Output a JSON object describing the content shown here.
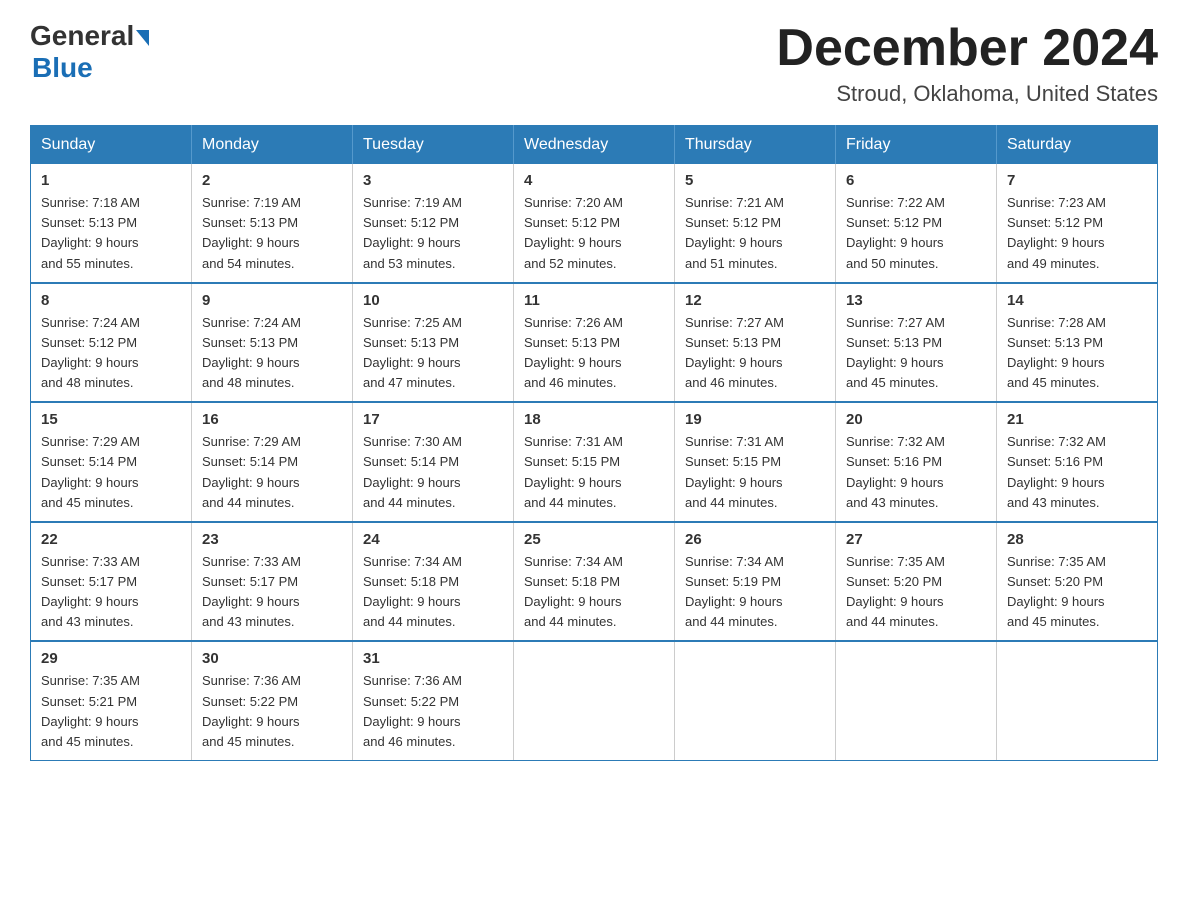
{
  "header": {
    "logo_general": "General",
    "logo_blue": "Blue",
    "title": "December 2024",
    "subtitle": "Stroud, Oklahoma, United States"
  },
  "columns": [
    "Sunday",
    "Monday",
    "Tuesday",
    "Wednesday",
    "Thursday",
    "Friday",
    "Saturday"
  ],
  "weeks": [
    [
      {
        "day": "1",
        "sunrise": "7:18 AM",
        "sunset": "5:13 PM",
        "daylight": "9 hours and 55 minutes."
      },
      {
        "day": "2",
        "sunrise": "7:19 AM",
        "sunset": "5:13 PM",
        "daylight": "9 hours and 54 minutes."
      },
      {
        "day": "3",
        "sunrise": "7:19 AM",
        "sunset": "5:12 PM",
        "daylight": "9 hours and 53 minutes."
      },
      {
        "day": "4",
        "sunrise": "7:20 AM",
        "sunset": "5:12 PM",
        "daylight": "9 hours and 52 minutes."
      },
      {
        "day": "5",
        "sunrise": "7:21 AM",
        "sunset": "5:12 PM",
        "daylight": "9 hours and 51 minutes."
      },
      {
        "day": "6",
        "sunrise": "7:22 AM",
        "sunset": "5:12 PM",
        "daylight": "9 hours and 50 minutes."
      },
      {
        "day": "7",
        "sunrise": "7:23 AM",
        "sunset": "5:12 PM",
        "daylight": "9 hours and 49 minutes."
      }
    ],
    [
      {
        "day": "8",
        "sunrise": "7:24 AM",
        "sunset": "5:12 PM",
        "daylight": "9 hours and 48 minutes."
      },
      {
        "day": "9",
        "sunrise": "7:24 AM",
        "sunset": "5:13 PM",
        "daylight": "9 hours and 48 minutes."
      },
      {
        "day": "10",
        "sunrise": "7:25 AM",
        "sunset": "5:13 PM",
        "daylight": "9 hours and 47 minutes."
      },
      {
        "day": "11",
        "sunrise": "7:26 AM",
        "sunset": "5:13 PM",
        "daylight": "9 hours and 46 minutes."
      },
      {
        "day": "12",
        "sunrise": "7:27 AM",
        "sunset": "5:13 PM",
        "daylight": "9 hours and 46 minutes."
      },
      {
        "day": "13",
        "sunrise": "7:27 AM",
        "sunset": "5:13 PM",
        "daylight": "9 hours and 45 minutes."
      },
      {
        "day": "14",
        "sunrise": "7:28 AM",
        "sunset": "5:13 PM",
        "daylight": "9 hours and 45 minutes."
      }
    ],
    [
      {
        "day": "15",
        "sunrise": "7:29 AM",
        "sunset": "5:14 PM",
        "daylight": "9 hours and 45 minutes."
      },
      {
        "day": "16",
        "sunrise": "7:29 AM",
        "sunset": "5:14 PM",
        "daylight": "9 hours and 44 minutes."
      },
      {
        "day": "17",
        "sunrise": "7:30 AM",
        "sunset": "5:14 PM",
        "daylight": "9 hours and 44 minutes."
      },
      {
        "day": "18",
        "sunrise": "7:31 AM",
        "sunset": "5:15 PM",
        "daylight": "9 hours and 44 minutes."
      },
      {
        "day": "19",
        "sunrise": "7:31 AM",
        "sunset": "5:15 PM",
        "daylight": "9 hours and 44 minutes."
      },
      {
        "day": "20",
        "sunrise": "7:32 AM",
        "sunset": "5:16 PM",
        "daylight": "9 hours and 43 minutes."
      },
      {
        "day": "21",
        "sunrise": "7:32 AM",
        "sunset": "5:16 PM",
        "daylight": "9 hours and 43 minutes."
      }
    ],
    [
      {
        "day": "22",
        "sunrise": "7:33 AM",
        "sunset": "5:17 PM",
        "daylight": "9 hours and 43 minutes."
      },
      {
        "day": "23",
        "sunrise": "7:33 AM",
        "sunset": "5:17 PM",
        "daylight": "9 hours and 43 minutes."
      },
      {
        "day": "24",
        "sunrise": "7:34 AM",
        "sunset": "5:18 PM",
        "daylight": "9 hours and 44 minutes."
      },
      {
        "day": "25",
        "sunrise": "7:34 AM",
        "sunset": "5:18 PM",
        "daylight": "9 hours and 44 minutes."
      },
      {
        "day": "26",
        "sunrise": "7:34 AM",
        "sunset": "5:19 PM",
        "daylight": "9 hours and 44 minutes."
      },
      {
        "day": "27",
        "sunrise": "7:35 AM",
        "sunset": "5:20 PM",
        "daylight": "9 hours and 44 minutes."
      },
      {
        "day": "28",
        "sunrise": "7:35 AM",
        "sunset": "5:20 PM",
        "daylight": "9 hours and 45 minutes."
      }
    ],
    [
      {
        "day": "29",
        "sunrise": "7:35 AM",
        "sunset": "5:21 PM",
        "daylight": "9 hours and 45 minutes."
      },
      {
        "day": "30",
        "sunrise": "7:36 AM",
        "sunset": "5:22 PM",
        "daylight": "9 hours and 45 minutes."
      },
      {
        "day": "31",
        "sunrise": "7:36 AM",
        "sunset": "5:22 PM",
        "daylight": "9 hours and 46 minutes."
      },
      null,
      null,
      null,
      null
    ]
  ],
  "labels": {
    "sunrise_prefix": "Sunrise: ",
    "sunset_prefix": "Sunset: ",
    "daylight_prefix": "Daylight: "
  }
}
